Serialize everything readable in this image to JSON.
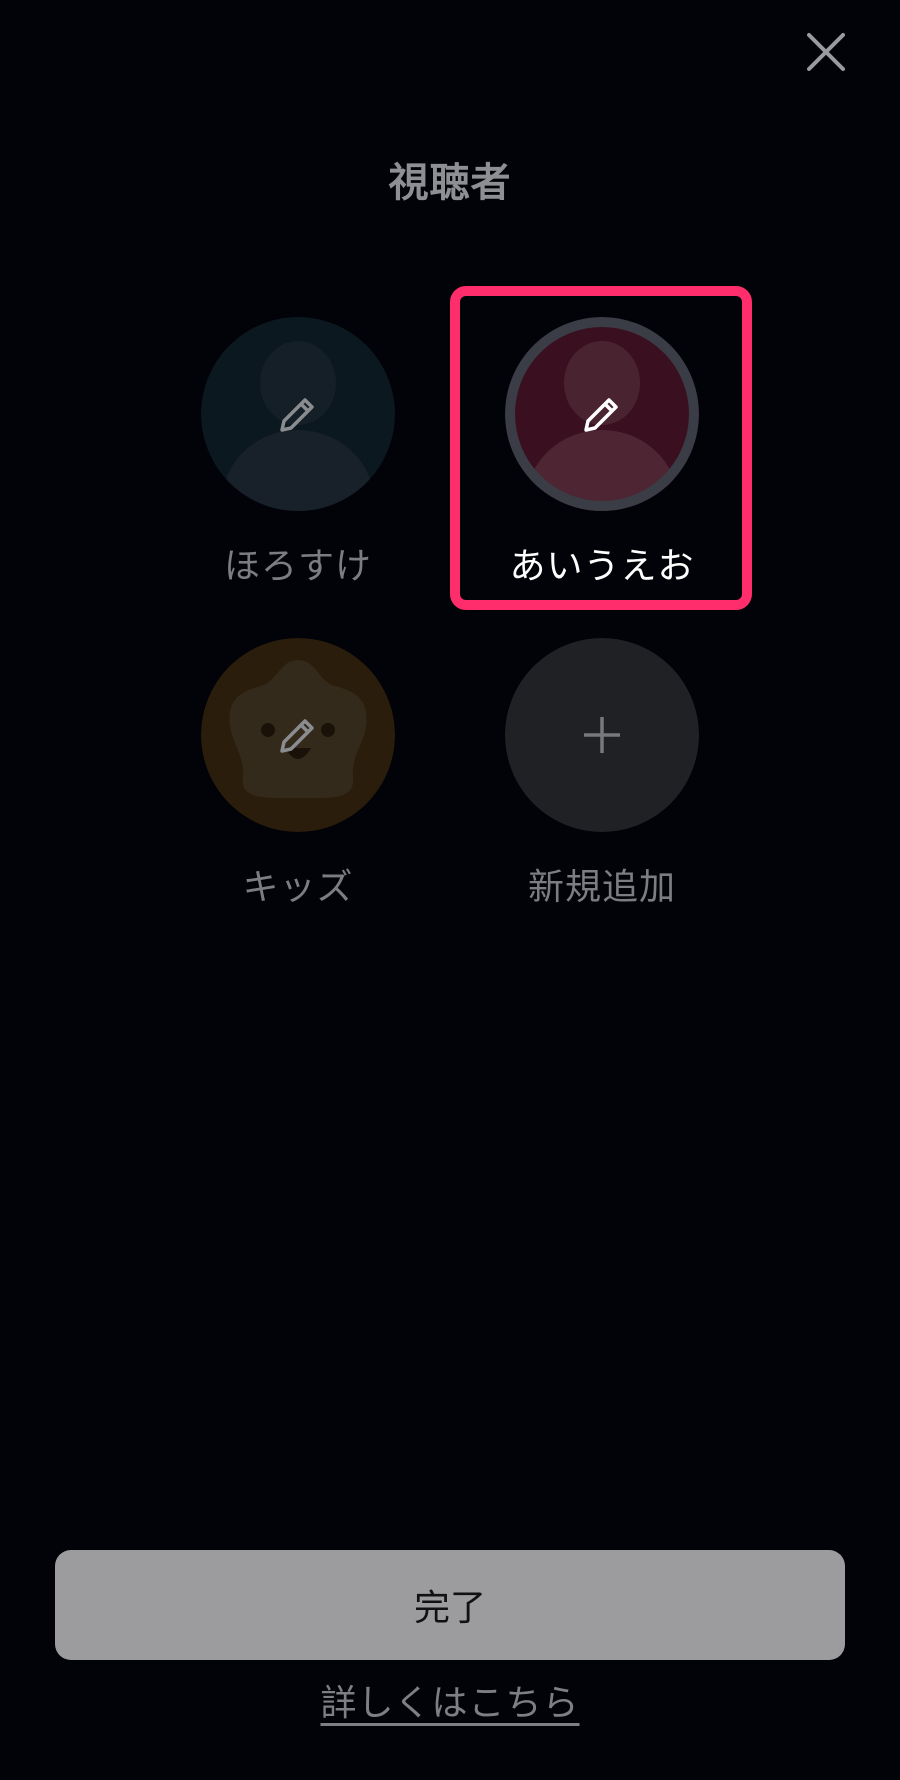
{
  "header": {
    "title": "視聴者",
    "close_icon": "close-icon"
  },
  "profiles": [
    {
      "name": "ほろすけ",
      "icon": "pencil-icon",
      "avatar": "person-silhouette",
      "color": "#0b1820",
      "selected": false
    },
    {
      "name": "あいうえお",
      "icon": "pencil-icon",
      "avatar": "person-silhouette",
      "color": "#3a1020",
      "selected": true
    },
    {
      "name": "キッズ",
      "icon": "pencil-icon",
      "avatar": "star-face",
      "color": "#2a1d0c",
      "selected": false
    }
  ],
  "add_profile": {
    "label": "新規追加",
    "icon": "plus-icon"
  },
  "footer": {
    "done_label": "完了",
    "more_link": "詳しくはこちら"
  },
  "colors": {
    "background": "#020308",
    "highlight": "#ff2d6c",
    "done_button": "#9c9c9e"
  }
}
